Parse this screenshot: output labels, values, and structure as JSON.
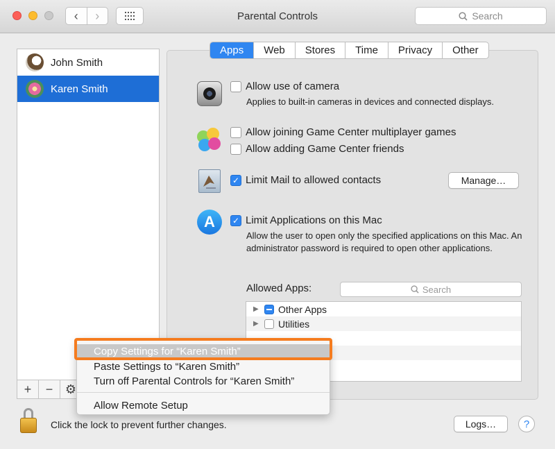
{
  "window": {
    "title": "Parental Controls",
    "search_placeholder": "Search"
  },
  "users": [
    {
      "name": "John Smith",
      "avatar": "eagle-avatar",
      "selected": false
    },
    {
      "name": "Karen Smith",
      "avatar": "flower-avatar",
      "selected": true
    }
  ],
  "list_toolbar": {
    "add": "+",
    "remove": "−",
    "gear": "⚙"
  },
  "tabs": [
    "Apps",
    "Web",
    "Stores",
    "Time",
    "Privacy",
    "Other"
  ],
  "active_tab": "Apps",
  "camera": {
    "label": "Allow use of camera",
    "description": "Applies to built-in cameras in devices and connected displays.",
    "checked": false
  },
  "game_center": {
    "multiplayer_label": "Allow joining Game Center multiplayer games",
    "friends_label": "Allow adding Game Center friends",
    "multiplayer_checked": false,
    "friends_checked": false
  },
  "mail": {
    "label": "Limit Mail to allowed contacts",
    "checked": true,
    "manage_button": "Manage…"
  },
  "applications": {
    "label": "Limit Applications on this Mac",
    "checked": true,
    "description": "Allow the user to open only the specified applications on this Mac. An administrator password is required to open other applications.",
    "allowed_label": "Allowed Apps:",
    "search_placeholder": "Search",
    "rows": [
      {
        "name": "Other Apps",
        "state": "mixed"
      },
      {
        "name": "Utilities",
        "state": "unchecked"
      }
    ]
  },
  "context_menu": {
    "items": [
      "Copy Settings for “Karen Smith”",
      "Paste Settings to “Karen Smith”",
      "Turn off Parental Controls for “Karen Smith”",
      "Allow Remote Setup"
    ],
    "highlighted_index": 0,
    "highlight_color": "#f57c1f"
  },
  "footer": {
    "lock_text": "Click the lock to prevent further changes.",
    "logs_button": "Logs…",
    "help": "?"
  },
  "colors": {
    "accent": "#2f86f1",
    "selection": "#1e6ed6"
  }
}
